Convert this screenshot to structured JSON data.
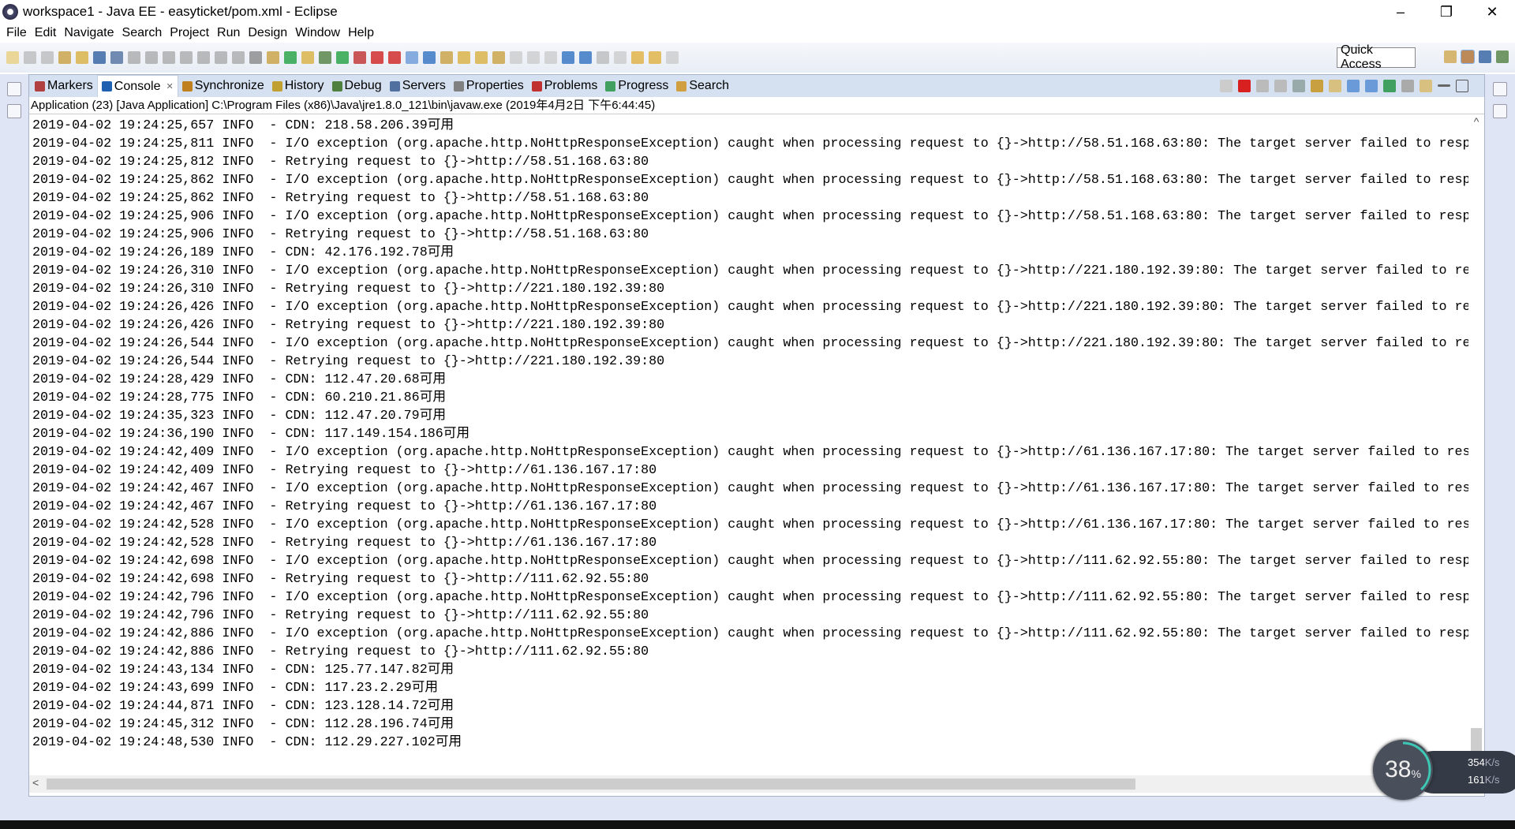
{
  "window": {
    "title": "workspace1 - Java EE - easyticket/pom.xml - Eclipse",
    "minimize": "–",
    "maximize": "❐",
    "close": "✕"
  },
  "menu": [
    "File",
    "Edit",
    "Navigate",
    "Search",
    "Project",
    "Run",
    "Design",
    "Window",
    "Help"
  ],
  "toolbar": {
    "quick_access": "Quick Access"
  },
  "tabs": [
    {
      "label": "Markers",
      "color": "#b04040"
    },
    {
      "label": "Console",
      "color": "#2060b0",
      "active": true,
      "close": "✕"
    },
    {
      "label": "Synchronize",
      "color": "#c08020"
    },
    {
      "label": "History",
      "color": "#c0a030"
    },
    {
      "label": "Debug",
      "color": "#508040"
    },
    {
      "label": "Servers",
      "color": "#5070a0"
    },
    {
      "label": "Properties",
      "color": "#808080"
    },
    {
      "label": "Problems",
      "color": "#c03030"
    },
    {
      "label": "Progress",
      "color": "#40a060"
    },
    {
      "label": "Search",
      "color": "#d0a040"
    }
  ],
  "console": {
    "description": "Application (23) [Java Application] C:\\Program Files (x86)\\Java\\jre1.8.0_121\\bin\\javaw.exe (2019年4月2日 下午6:44:45)",
    "lines": [
      "2019-04-02 19:24:25,657 INFO  - CDN: 218.58.206.39可用",
      "2019-04-02 19:24:25,811 INFO  - I/O exception (org.apache.http.NoHttpResponseException) caught when processing request to {}->http://58.51.168.63:80: The target server failed to resp",
      "2019-04-02 19:24:25,812 INFO  - Retrying request to {}->http://58.51.168.63:80",
      "2019-04-02 19:24:25,862 INFO  - I/O exception (org.apache.http.NoHttpResponseException) caught when processing request to {}->http://58.51.168.63:80: The target server failed to resp",
      "2019-04-02 19:24:25,862 INFO  - Retrying request to {}->http://58.51.168.63:80",
      "2019-04-02 19:24:25,906 INFO  - I/O exception (org.apache.http.NoHttpResponseException) caught when processing request to {}->http://58.51.168.63:80: The target server failed to resp",
      "2019-04-02 19:24:25,906 INFO  - Retrying request to {}->http://58.51.168.63:80",
      "2019-04-02 19:24:26,189 INFO  - CDN: 42.176.192.78可用",
      "2019-04-02 19:24:26,310 INFO  - I/O exception (org.apache.http.NoHttpResponseException) caught when processing request to {}->http://221.180.192.39:80: The target server failed to re",
      "2019-04-02 19:24:26,310 INFO  - Retrying request to {}->http://221.180.192.39:80",
      "2019-04-02 19:24:26,426 INFO  - I/O exception (org.apache.http.NoHttpResponseException) caught when processing request to {}->http://221.180.192.39:80: The target server failed to re",
      "2019-04-02 19:24:26,426 INFO  - Retrying request to {}->http://221.180.192.39:80",
      "2019-04-02 19:24:26,544 INFO  - I/O exception (org.apache.http.NoHttpResponseException) caught when processing request to {}->http://221.180.192.39:80: The target server failed to re",
      "2019-04-02 19:24:26,544 INFO  - Retrying request to {}->http://221.180.192.39:80",
      "2019-04-02 19:24:28,429 INFO  - CDN: 112.47.20.68可用",
      "2019-04-02 19:24:28,775 INFO  - CDN: 60.210.21.86可用",
      "2019-04-02 19:24:35,323 INFO  - CDN: 112.47.20.79可用",
      "2019-04-02 19:24:36,190 INFO  - CDN: 117.149.154.186可用",
      "2019-04-02 19:24:42,409 INFO  - I/O exception (org.apache.http.NoHttpResponseException) caught when processing request to {}->http://61.136.167.17:80: The target server failed to res",
      "2019-04-02 19:24:42,409 INFO  - Retrying request to {}->http://61.136.167.17:80",
      "2019-04-02 19:24:42,467 INFO  - I/O exception (org.apache.http.NoHttpResponseException) caught when processing request to {}->http://61.136.167.17:80: The target server failed to res",
      "2019-04-02 19:24:42,467 INFO  - Retrying request to {}->http://61.136.167.17:80",
      "2019-04-02 19:24:42,528 INFO  - I/O exception (org.apache.http.NoHttpResponseException) caught when processing request to {}->http://61.136.167.17:80: The target server failed to res",
      "2019-04-02 19:24:42,528 INFO  - Retrying request to {}->http://61.136.167.17:80",
      "2019-04-02 19:24:42,698 INFO  - I/O exception (org.apache.http.NoHttpResponseException) caught when processing request to {}->http://111.62.92.55:80: The target server failed to resp",
      "2019-04-02 19:24:42,698 INFO  - Retrying request to {}->http://111.62.92.55:80",
      "2019-04-02 19:24:42,796 INFO  - I/O exception (org.apache.http.NoHttpResponseException) caught when processing request to {}->http://111.62.92.55:80: The target server failed to resp",
      "2019-04-02 19:24:42,796 INFO  - Retrying request to {}->http://111.62.92.55:80",
      "2019-04-02 19:24:42,886 INFO  - I/O exception (org.apache.http.NoHttpResponseException) caught when processing request to {}->http://111.62.92.55:80: The target server failed to resp",
      "2019-04-02 19:24:42,886 INFO  - Retrying request to {}->http://111.62.92.55:80",
      "2019-04-02 19:24:43,134 INFO  - CDN: 125.77.147.82可用",
      "2019-04-02 19:24:43,699 INFO  - CDN: 117.23.2.29可用",
      "2019-04-02 19:24:44,871 INFO  - CDN: 123.128.14.72可用",
      "2019-04-02 19:24:45,312 INFO  - CDN: 112.28.196.74可用",
      "2019-04-02 19:24:48,530 INFO  - CDN: 112.29.227.102可用"
    ]
  },
  "network_widget": {
    "percent": "38",
    "percent_unit": "%",
    "percent_value": 38,
    "upload": "354",
    "upload_unit": "K/s",
    "download": "161",
    "download_unit": "K/s",
    "up_arrow": "↑",
    "down_arrow": "↓"
  },
  "colors": {
    "accent": "#d5e1f0",
    "gauge_ring": "#3cc8b4"
  }
}
